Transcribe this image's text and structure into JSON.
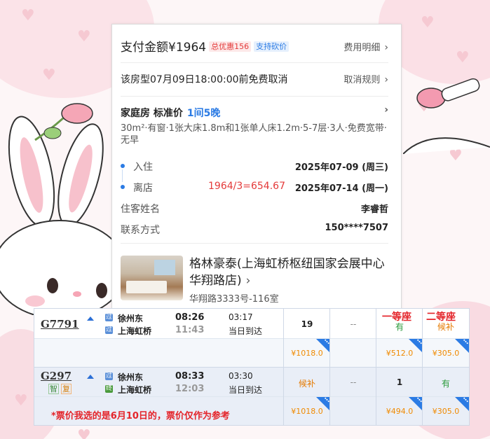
{
  "colors": {
    "accent_blue": "#2b7be4",
    "price_red": "#e43a3a",
    "price_orange": "#f08a00",
    "available_green": "#2a9a3a",
    "note_red": "#e4242a"
  },
  "booking": {
    "pay_title": "支付金额¥1964",
    "discount_badge": "总优惠156",
    "haggle_badge": "支持砍价",
    "fee_detail_link": "费用明细",
    "cancel_text": "该房型07月09日18:00:00前免费取消",
    "cancel_rule_link": "取消规则",
    "room_name": "家庭房 标准价",
    "room_nights": "1间5晚",
    "room_desc": "30m²·有窗·1张大床1.8m和1张单人床1.2m·5-7层·3人·免费宽带·无早",
    "checkin_label": "入住",
    "checkin_date": "2025年07-09 (周三)",
    "checkout_label": "离店",
    "checkout_date": "2025年07-14 (周一)",
    "calc_note": "1964/3=654.67",
    "guest_label": "住客姓名",
    "guest_name": "李睿哲",
    "contact_label": "联系方式",
    "contact_value": "150****7507",
    "hotel_name": "格林豪泰(上海虹桥枢纽国家会展中心华翔路店)",
    "hotel_address": "华翔路3333号-116室"
  },
  "trains": {
    "headers": {
      "first_class": "一等座",
      "second_class": "二等座"
    },
    "rows": [
      {
        "train_no": "G7791",
        "from_tag": "过",
        "from": "徐州东",
        "depart": "08:26",
        "to_tag": "过",
        "to": "上海虹桥",
        "arrive": "11:43",
        "duration": "03:17",
        "arrive_day": "当日到达",
        "col_business": "19",
        "col_other": "--",
        "first_status": "有",
        "second_status": "候补",
        "price_business": "¥1018.0",
        "price_first": "¥512.0",
        "price_second": "¥305.0"
      },
      {
        "train_no": "G297",
        "badge1": "智",
        "badge2": "复",
        "from_tag": "过",
        "from": "徐州东",
        "depart": "08:33",
        "to_tag": "终",
        "to": "上海虹桥",
        "arrive": "12:03",
        "duration": "03:30",
        "arrive_day": "当日到达",
        "col_business": "候补",
        "col_other": "--",
        "first_status": "1",
        "second_status": "有",
        "price_business": "¥1018.0",
        "price_first": "¥494.0",
        "price_second": "¥305.0"
      }
    ],
    "note": "*票价我选的是6月10日的，票价仅作为参考"
  }
}
